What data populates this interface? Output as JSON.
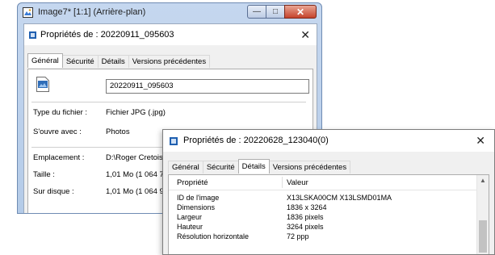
{
  "app": {
    "title": "Image7* [1:1] (Arrière-plan)",
    "caption": {
      "minimize": "—",
      "maximize": "□",
      "close": "✕"
    }
  },
  "dialog1": {
    "title": "Propriétés de : 20220911_095603",
    "close": "✕",
    "tabs": [
      "Général",
      "Sécurité",
      "Détails",
      "Versions précédentes"
    ],
    "active_tab": "Général",
    "filename": "20220911_095603",
    "fields": {
      "type_label": "Type du fichier :",
      "type_value": "Fichier JPG (.jpg)",
      "opens_label": "S'ouvre avec :",
      "opens_value": "Photos",
      "location_label": "Emplacement :",
      "location_value": "D:\\Roger Cretois",
      "size_label": "Taille :",
      "size_value": "1,01 Mo (1 064 7",
      "disk_label": "Sur disque :",
      "disk_value": "1,01 Mo (1 064 9"
    }
  },
  "dialog2": {
    "title": "Propriétés de : 20220628_123040(0)",
    "close": "✕",
    "tabs": [
      "Général",
      "Sécurité",
      "Détails",
      "Versions précédentes"
    ],
    "active_tab": "Détails",
    "columns": {
      "property": "Propriété",
      "value": "Valeur"
    },
    "rows": [
      {
        "k": "ID de l'image",
        "v": "X13LSKA00CM X13LSMD01MA"
      },
      {
        "k": "Dimensions",
        "v": "1836 x 3264"
      },
      {
        "k": "Largeur",
        "v": "1836 pixels"
      },
      {
        "k": "Hauteur",
        "v": "3264 pixels"
      },
      {
        "k": "Résolution horizontale",
        "v": "72 ppp"
      }
    ]
  },
  "colors": {
    "close_red": "#c5432c",
    "title_bar": "#c5d7ef",
    "selected_tab": "#ffffff"
  },
  "icons": [
    "app-icon",
    "properties-icon",
    "jpg-file-icon",
    "scroll-up-icon"
  ]
}
